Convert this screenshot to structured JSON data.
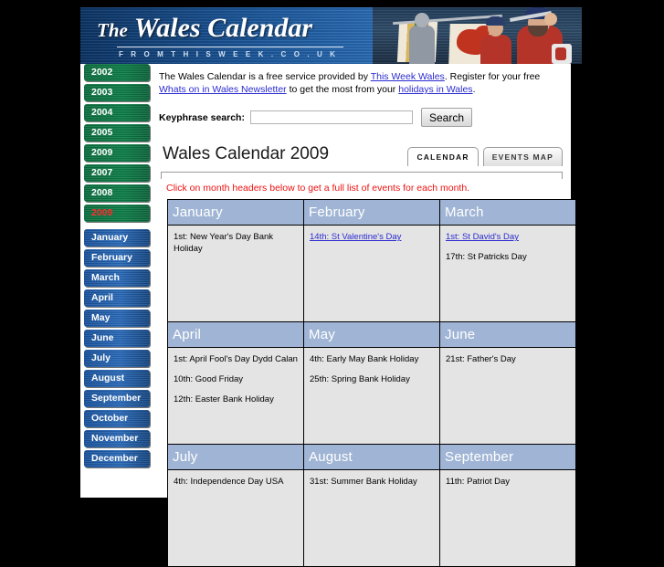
{
  "banner": {
    "title_the": "The",
    "title_main": "Wales Calendar",
    "subtitle": "F R O M   T H I S W E E K . C O . U K",
    "photo_alt": "trumpeters-with-welsh-dragon-banners"
  },
  "intro": {
    "text_1": "The Wales Calendar is a free service provided by ",
    "link_1": "This Week Wales",
    "text_2": ". Register for your free ",
    "link_2": "Whats on in Wales Newsletter",
    "text_3": " to get the most from your ",
    "link_3": "holidays in Wales",
    "text_4": "."
  },
  "search": {
    "label": "Keyphrase search:",
    "value": "",
    "placeholder": "",
    "button_label": "Search"
  },
  "page": {
    "title": "Wales Calendar 2009",
    "notice": "Click on month headers below to get a full list of events for each month."
  },
  "tabs": [
    {
      "label": "CALENDAR",
      "active": true
    },
    {
      "label": "EVENTS MAP",
      "active": false
    }
  ],
  "sidebar": {
    "years": [
      {
        "label": "2002",
        "current": false
      },
      {
        "label": "2003",
        "current": false
      },
      {
        "label": "2004",
        "current": false
      },
      {
        "label": "2005",
        "current": false
      },
      {
        "label": "2009",
        "current": false
      },
      {
        "label": "2007",
        "current": false
      },
      {
        "label": "2008",
        "current": false
      },
      {
        "label": "2009",
        "current": true
      }
    ],
    "months": [
      {
        "label": "January"
      },
      {
        "label": "February"
      },
      {
        "label": "March"
      },
      {
        "label": "April"
      },
      {
        "label": "May"
      },
      {
        "label": "June"
      },
      {
        "label": "July"
      },
      {
        "label": "August"
      },
      {
        "label": "September"
      },
      {
        "label": "October"
      },
      {
        "label": "November"
      },
      {
        "label": "December"
      }
    ]
  },
  "calendar": {
    "rows": [
      [
        {
          "month": "January",
          "events": [
            {
              "text": "1st: New Year's Day Bank Holiday",
              "link": false
            }
          ]
        },
        {
          "month": "February",
          "events": [
            {
              "text": "14th: St Valentine's Day",
              "link": true
            }
          ]
        },
        {
          "month": "March",
          "events": [
            {
              "text": "1st: St David's Day",
              "link": true
            },
            {
              "text": "17th: St Patricks Day",
              "link": false
            }
          ]
        }
      ],
      [
        {
          "month": "April",
          "events": [
            {
              "text": "1st: April Fool's Day Dydd Calan",
              "link": false
            },
            {
              "text": "10th: Good Friday",
              "link": false
            },
            {
              "text": "12th: Easter Bank Holiday",
              "link": false
            }
          ]
        },
        {
          "month": "May",
          "events": [
            {
              "text": "4th: Early May Bank Holiday",
              "link": false
            },
            {
              "text": "25th: Spring Bank Holiday",
              "link": false
            }
          ]
        },
        {
          "month": "June",
          "events": [
            {
              "text": "21st: Father's Day",
              "link": false
            }
          ]
        }
      ],
      [
        {
          "month": "July",
          "events": [
            {
              "text": "4th: Independence Day USA",
              "link": false
            }
          ]
        },
        {
          "month": "August",
          "events": [
            {
              "text": "31st: Summer Bank Holiday",
              "link": false
            }
          ]
        },
        {
          "month": "September",
          "events": [
            {
              "text": "11th: Patriot Day",
              "link": false
            }
          ]
        }
      ]
    ]
  },
  "colors": {
    "page_background": "#000000",
    "banner_blue": "#1b5699",
    "year_button_green": "#0b7a45",
    "month_button_blue": "#2767b5",
    "current_year_red": "#ff2a2a",
    "notice_red": "#ee1111",
    "month_header_blue": "#a0b5d5",
    "cell_grey": "#e4e4e4",
    "link_blue": "#2a2ad0"
  }
}
